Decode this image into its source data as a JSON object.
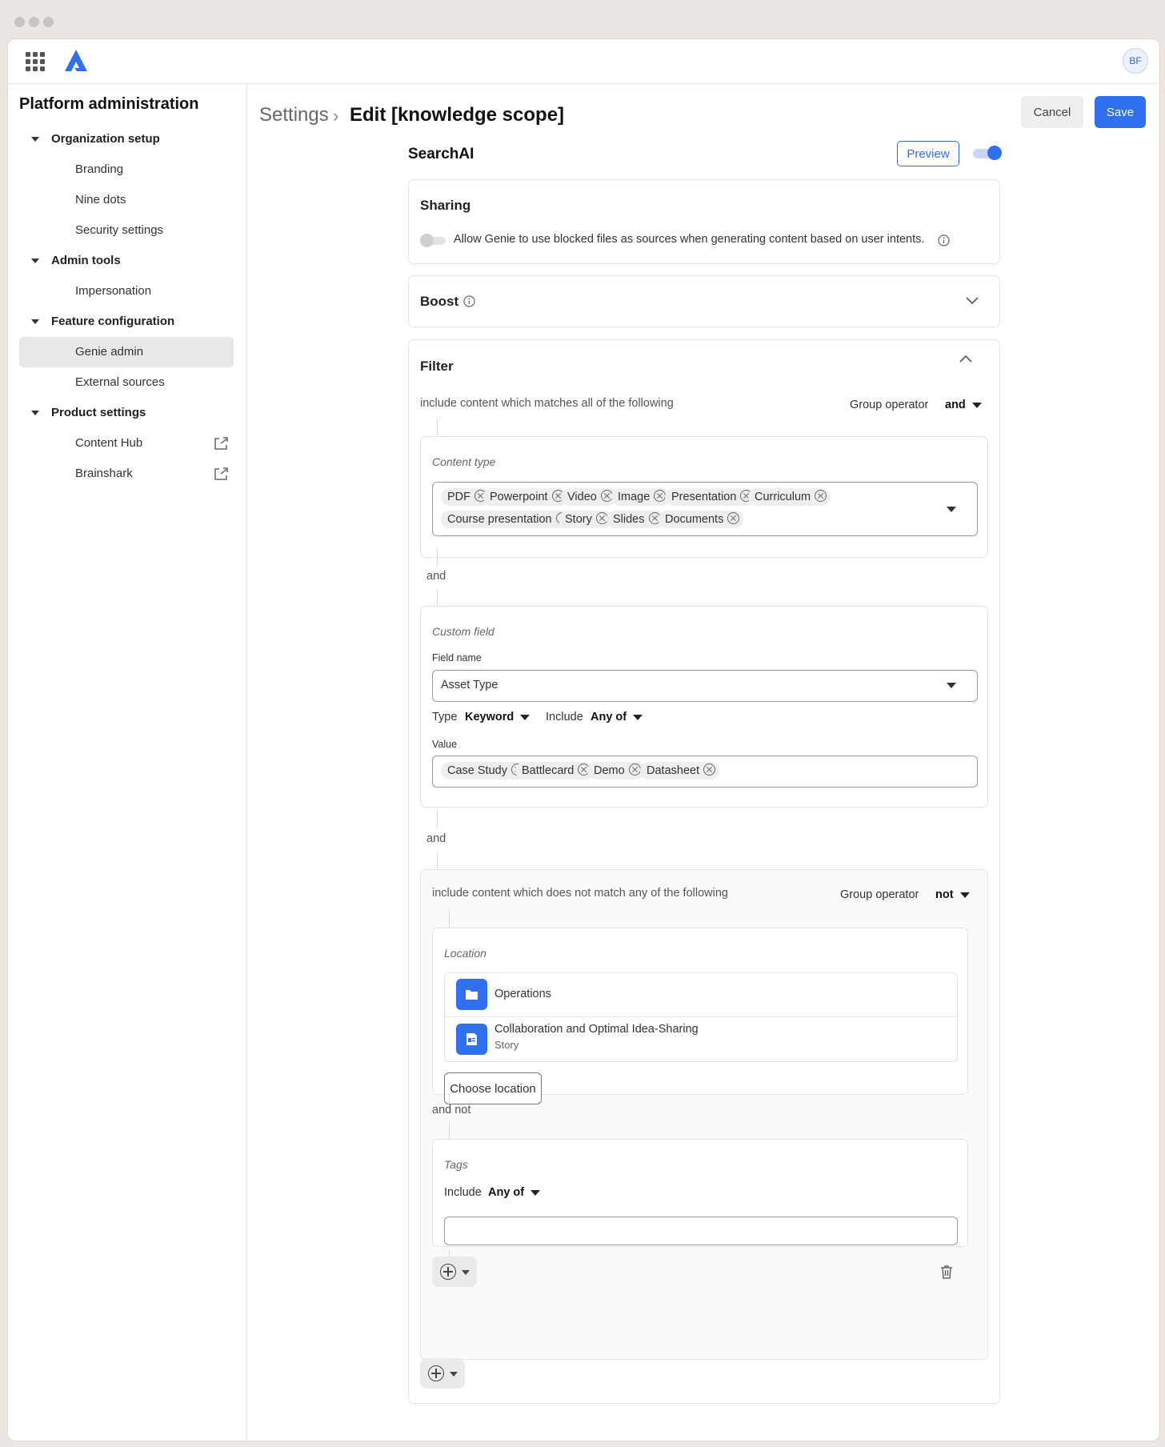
{
  "app": {
    "avatar_initials": "BF",
    "accent": "#2f6ff0"
  },
  "sidebar": {
    "title": "Platform administration",
    "items": [
      {
        "label": "Organization setup",
        "type": "section"
      },
      {
        "label": "Branding",
        "type": "child"
      },
      {
        "label": "Nine dots",
        "type": "child"
      },
      {
        "label": "Security settings",
        "type": "child"
      },
      {
        "label": "Admin tools",
        "type": "section"
      },
      {
        "label": "Impersonation",
        "type": "child"
      },
      {
        "label": "Feature configuration",
        "type": "section"
      },
      {
        "label": "Genie admin",
        "type": "child",
        "active": true
      },
      {
        "label": "External sources",
        "type": "child"
      },
      {
        "label": "Product settings",
        "type": "section"
      },
      {
        "label": "Content Hub",
        "type": "child",
        "icon": "external-link-icon"
      },
      {
        "label": "Brainshark",
        "type": "child",
        "icon": "external-link-icon"
      }
    ]
  },
  "header": {
    "breadcrumb_root": "Settings",
    "separator": "›",
    "title": "Edit [knowledge scope]",
    "cancel_label": "Cancel",
    "save_label": "Save"
  },
  "main": {
    "section_title": "SearchAI",
    "preview_label": "Preview",
    "enabled": true,
    "sharing": {
      "title": "Sharing",
      "toggle_label": "Allow Genie to use blocked files as sources when generating content based on user intents.",
      "toggle_on": false
    },
    "boost": {
      "title": "Boost"
    },
    "filter": {
      "title": "Filter",
      "group_desc": "include content which matches all of the following",
      "group_operator_label": "Group operator",
      "group_operator_value": "and",
      "content_type": {
        "label": "Content type",
        "chips_row1": [
          "PDF",
          "Powerpoint",
          "Video",
          "Image",
          "Presentation",
          "Curriculum"
        ],
        "chips_row2": [
          "Course presentation",
          "Story",
          "Slides",
          "Documents"
        ]
      },
      "connector1": "and",
      "custom_field": {
        "label": "Custom field",
        "field_name_label": "Field name",
        "field_name_value": "Asset Type",
        "type_label": "Type",
        "type_value": "Keyword",
        "include_label": "Include",
        "include_value": "Any of",
        "value_label": "Value",
        "chips": [
          "Case Study",
          "Battlecard",
          "Demo",
          "Datasheet"
        ]
      },
      "connector2": "and",
      "subgroup": {
        "desc": "include content which does not match any of the following",
        "group_operator_label": "Group operator",
        "group_operator_value": "not",
        "location": {
          "label": "Location",
          "items": [
            {
              "name": "Operations",
              "sub": "",
              "icon": "folder-icon"
            },
            {
              "name": "Collaboration and Optimal Idea-Sharing",
              "sub": "Story",
              "icon": "story-icon"
            }
          ],
          "choose_label": "Choose location"
        },
        "connector": "and not",
        "tags": {
          "label": "Tags",
          "include_label": "Include",
          "include_value": "Any of",
          "input_value": ""
        }
      }
    }
  }
}
